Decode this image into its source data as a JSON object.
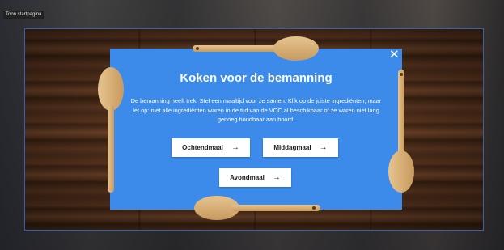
{
  "top_bar": {
    "home_label": "Toon startpagina"
  },
  "dialog": {
    "title": "Koken voor de bemanning",
    "description": "De bemanning heeft trek. Stel een maaltijd voor ze samen. Klik op de juiste ingrediënten, maar let op: niet alle ingrediënten waren in de tijd van de VOC al beschikbaar of ze waren niet lang genoeg houdbaar aan boord.",
    "close_icon": "close-icon",
    "buttons": [
      {
        "label": "Ochtendmaal",
        "icon": "arrow-right-icon"
      },
      {
        "label": "Middagmaal",
        "icon": "arrow-right-icon"
      },
      {
        "label": "Avondmaal",
        "icon": "arrow-right-icon"
      }
    ]
  },
  "colors": {
    "card_blue": "#3c8bea",
    "wood_dark": "#4a2b17",
    "spoon_wood": "#d9b27a",
    "button_bg": "#ffffff"
  }
}
